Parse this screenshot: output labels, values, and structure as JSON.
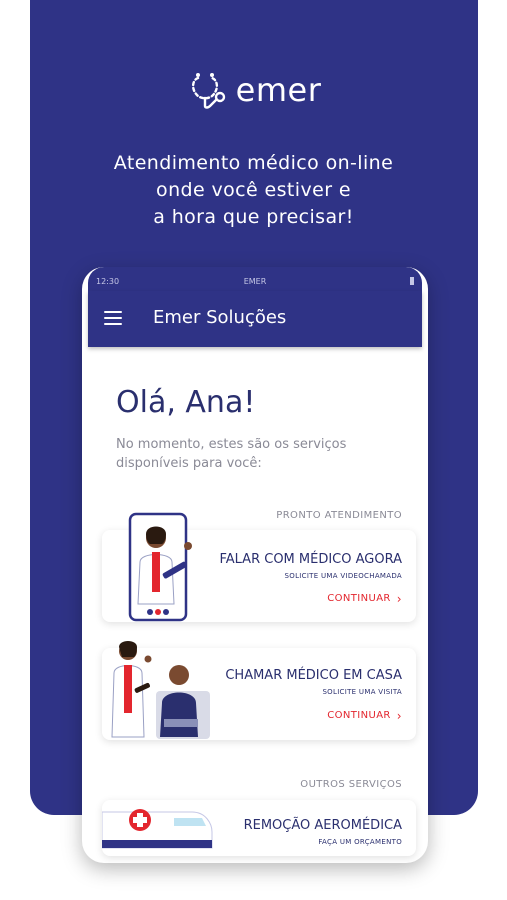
{
  "brand": {
    "name": "emer",
    "logo_icon": "stethoscope-icon"
  },
  "tagline": [
    "Atendimento médico on-line",
    "onde você estiver e",
    "a hora que precisar!"
  ],
  "phone": {
    "status_bar": {
      "time": "12:30",
      "carrier": "EMER"
    },
    "app_bar": {
      "title": "Emer Soluções",
      "menu_icon": "hamburger-menu-icon"
    },
    "greeting": "Olá, Ana!",
    "intro": "No momento, estes são os serviços disponíveis para você:",
    "sections": [
      {
        "label": "PRONTO ATENDIMENTO",
        "cards": [
          {
            "title": "FALAR COM MÉDICO AGORA",
            "subtitle": "SOLICITE UMA VIDEOCHAMADA",
            "cta": "CONTINUAR",
            "illustration": "doctor-on-phone-illustration"
          },
          {
            "title": "CHAMAR MÉDICO EM CASA",
            "subtitle": "SOLICITE UMA VISITA",
            "cta": "CONTINUAR",
            "illustration": "doctor-home-visit-illustration"
          }
        ]
      },
      {
        "label": "OUTROS SERVIÇOS",
        "cards": [
          {
            "title": "REMOÇÃO AEROMÉDICA",
            "subtitle": "FAÇA UM ORÇAMENTO",
            "illustration": "air-ambulance-illustration"
          }
        ]
      }
    ]
  },
  "colors": {
    "brand_blue": "#2f3386",
    "accent_red": "#e3262e",
    "text_gray": "#8a8a96",
    "title_blue": "#2a2f6e"
  }
}
